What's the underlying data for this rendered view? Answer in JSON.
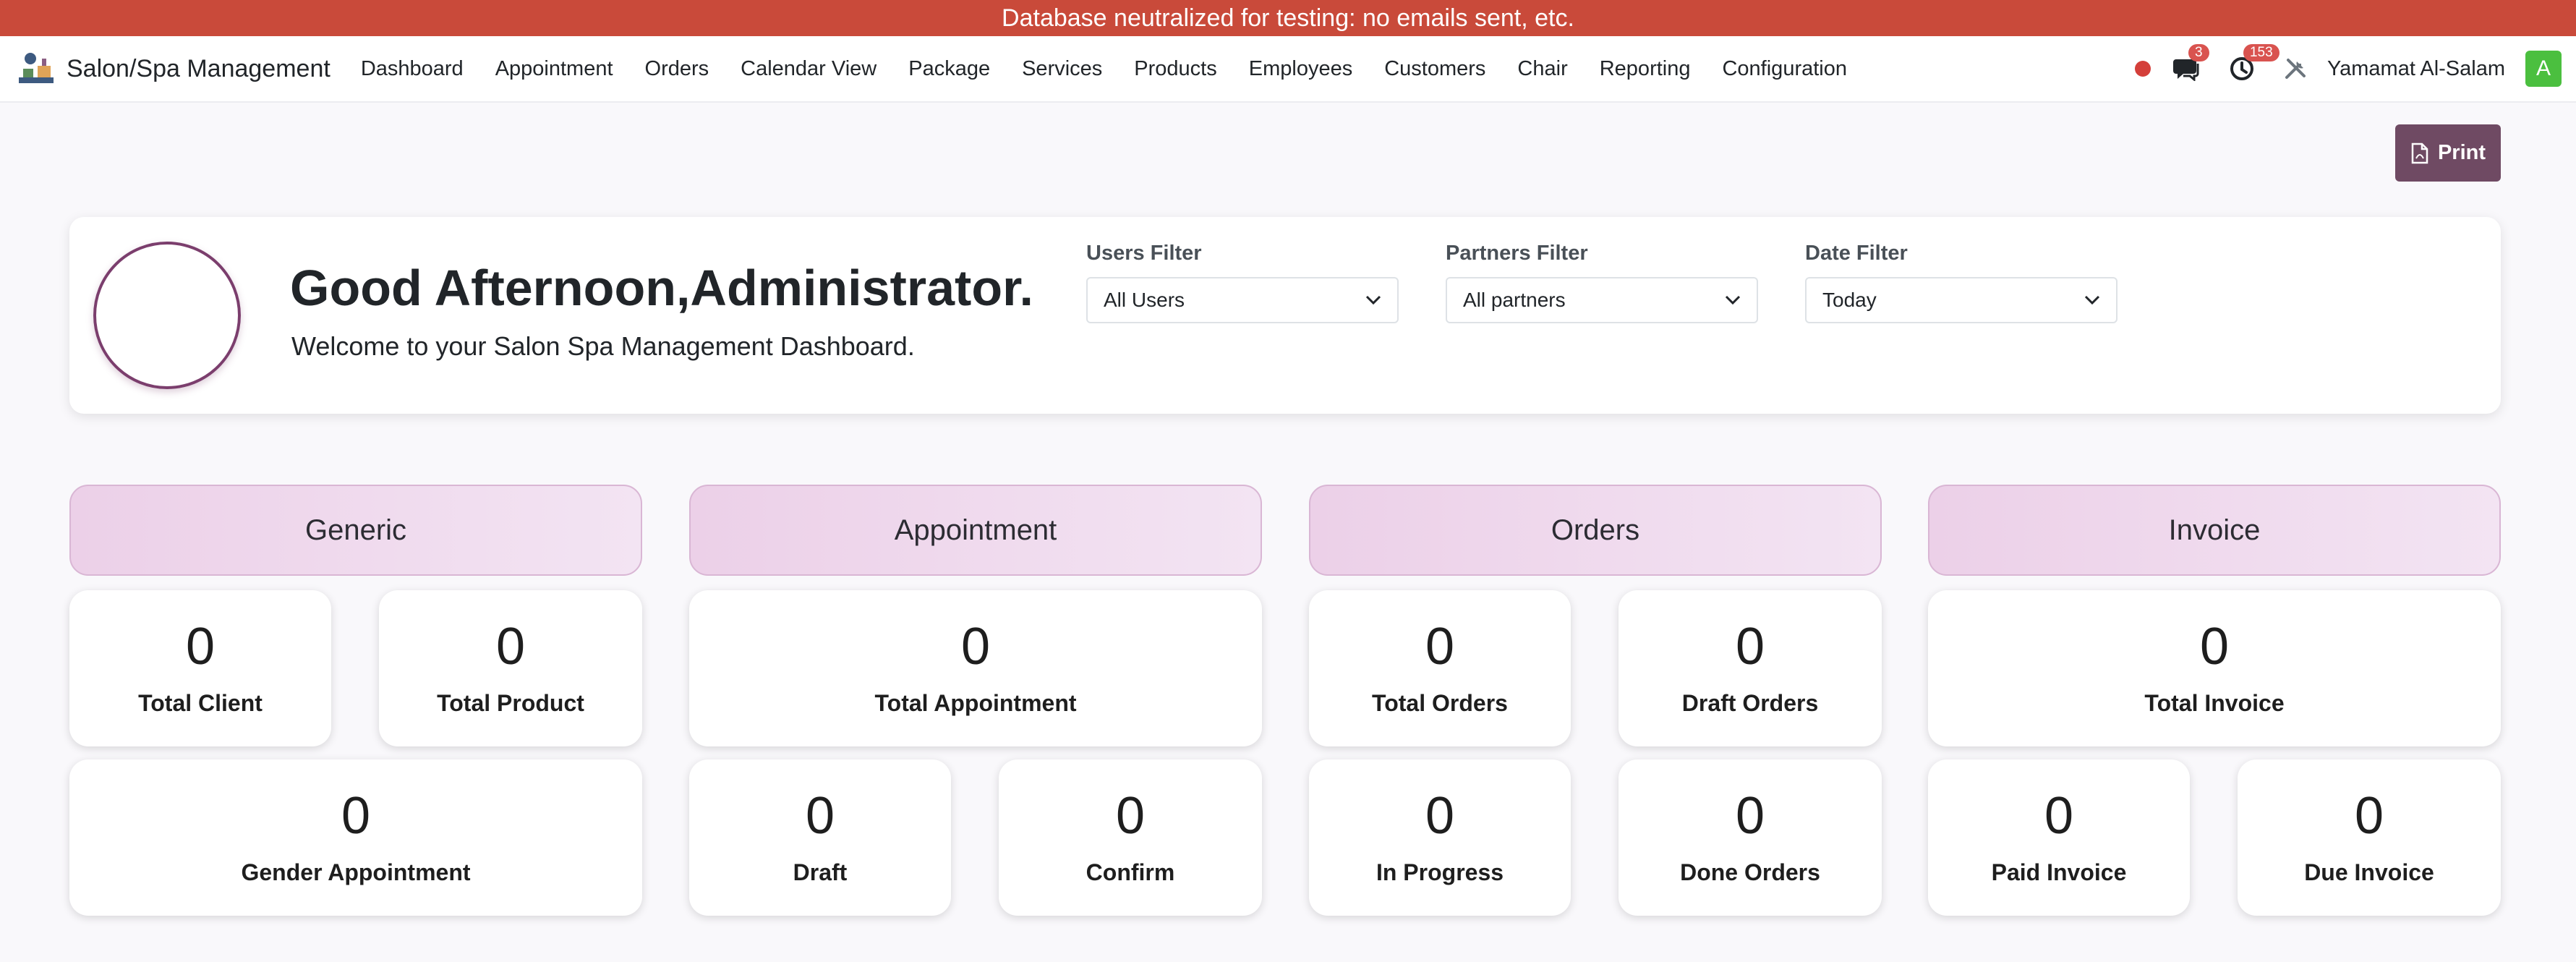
{
  "banner": "Database neutralized for testing: no emails sent, etc.",
  "brand": {
    "name": "Salon/Spa Management",
    "icon": "salon-logo-icon"
  },
  "menu": [
    "Dashboard",
    "Appointment",
    "Orders",
    "Calendar View",
    "Package",
    "Services",
    "Products",
    "Employees",
    "Customers",
    "Chair",
    "Reporting",
    "Configuration"
  ],
  "systray": {
    "messages_count": "3",
    "activities_count": "153",
    "user_name": "Yamamat Al-Salam",
    "avatar_letter": "A"
  },
  "print_label": "Print",
  "welcome": {
    "greeting": "Good Afternoon,Administrator.",
    "subtitle": "Welcome to your Salon Spa Management Dashboard."
  },
  "filters": {
    "users": {
      "label": "Users Filter",
      "value": "All Users"
    },
    "partners": {
      "label": "Partners Filter",
      "value": "All partners"
    },
    "date": {
      "label": "Date Filter",
      "value": "Today"
    }
  },
  "sections": {
    "generic": {
      "title": "Generic",
      "total_client": {
        "value": "0",
        "label": "Total Client"
      },
      "total_product": {
        "value": "0",
        "label": "Total Product"
      },
      "gender_appointment": {
        "value": "0",
        "label": "Gender Appointment"
      }
    },
    "appointment": {
      "title": "Appointment",
      "total_appointment": {
        "value": "0",
        "label": "Total Appointment"
      },
      "draft": {
        "value": "0",
        "label": "Draft"
      },
      "confirm": {
        "value": "0",
        "label": "Confirm"
      }
    },
    "orders": {
      "title": "Orders",
      "total_orders": {
        "value": "0",
        "label": "Total Orders"
      },
      "draft_orders": {
        "value": "0",
        "label": "Draft Orders"
      },
      "in_progress": {
        "value": "0",
        "label": "In Progress"
      },
      "done_orders": {
        "value": "0",
        "label": "Done Orders"
      }
    },
    "invoice": {
      "title": "Invoice",
      "total_invoice": {
        "value": "0",
        "label": "Total Invoice"
      },
      "paid_invoice": {
        "value": "0",
        "label": "Paid Invoice"
      },
      "due_invoice": {
        "value": "0",
        "label": "Due Invoice"
      }
    }
  },
  "colors": {
    "banner": "#c94a3a",
    "print_button": "#6f4a63",
    "avatar": "#4bbf3f",
    "badge": "#d9534f"
  }
}
